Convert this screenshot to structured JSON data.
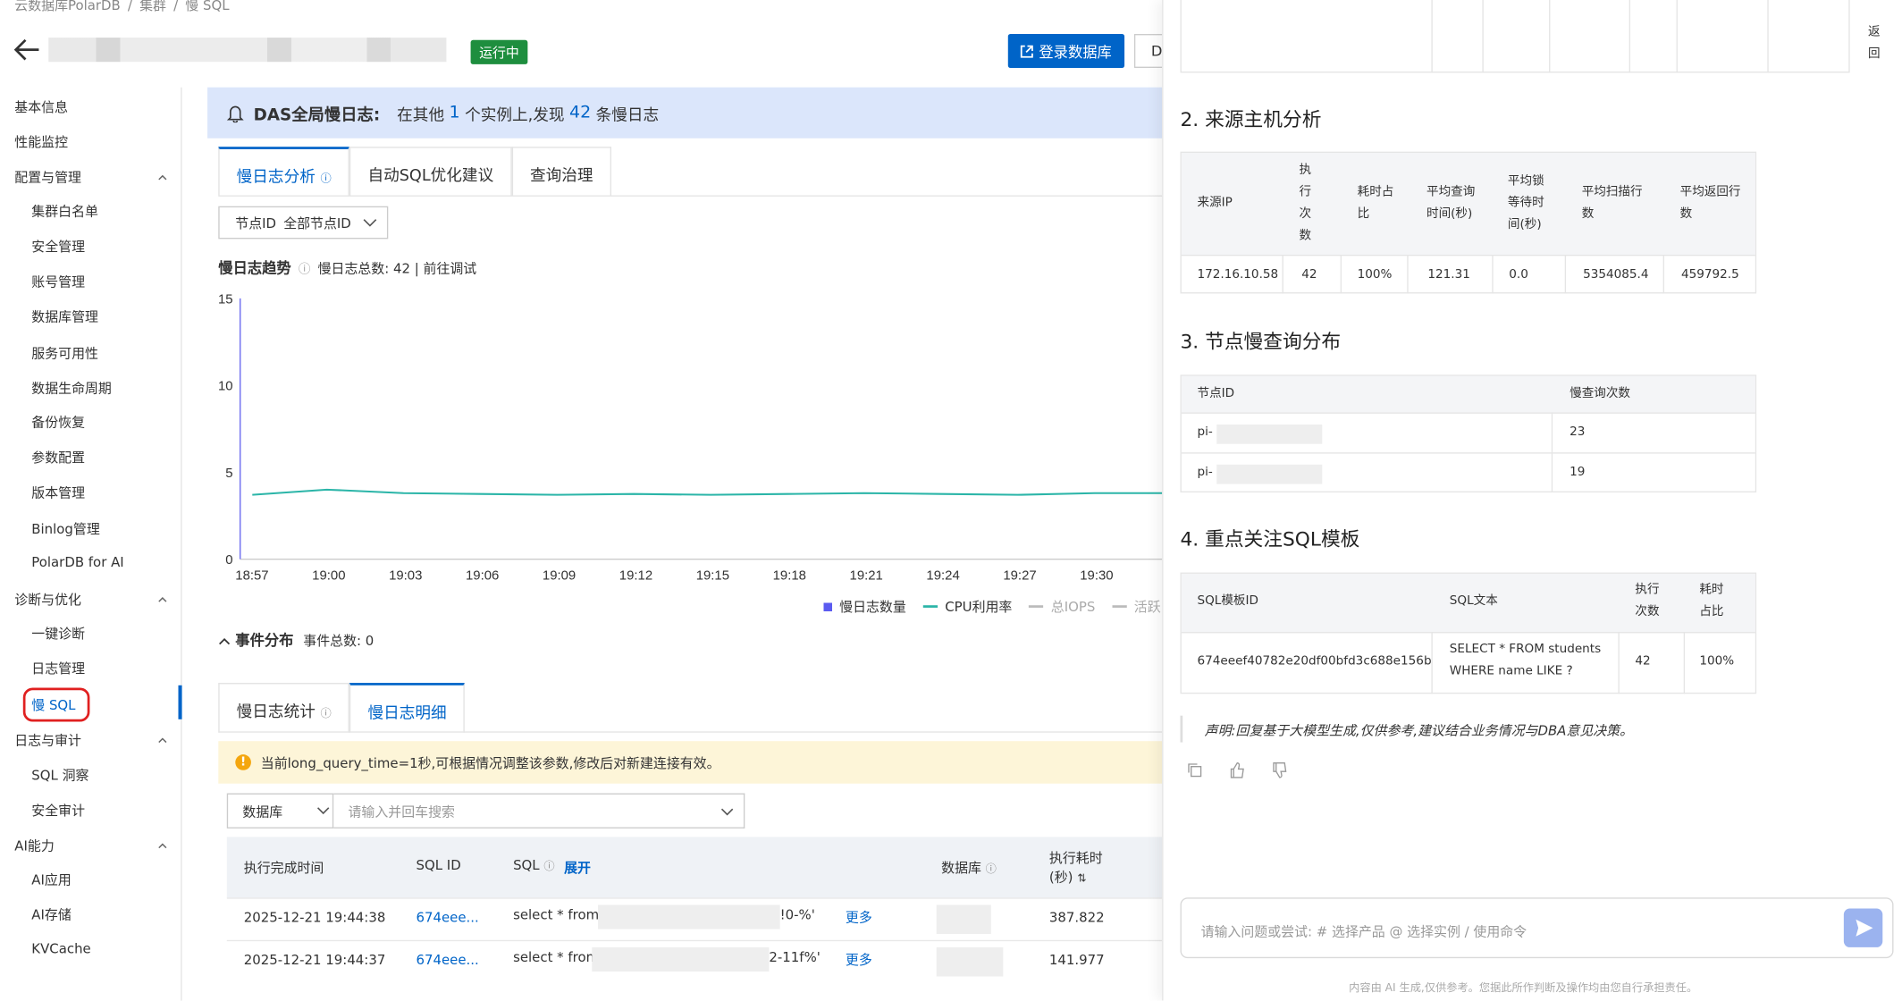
{
  "breadcrumb": [
    "云数据库PolarDB",
    "/",
    "集群",
    "/",
    "慢 SQL"
  ],
  "status_badge": "运行中",
  "header": {
    "login_db": "登录数据库",
    "d_button": "D"
  },
  "sidebar": [
    {
      "label": "基本信息"
    },
    {
      "label": "性能监控"
    },
    {
      "label": "配置与管理",
      "group": true
    },
    {
      "label": "集群白名单"
    },
    {
      "label": "安全管理"
    },
    {
      "label": "账号管理"
    },
    {
      "label": "数据库管理"
    },
    {
      "label": "服务可用性"
    },
    {
      "label": "数据生命周期"
    },
    {
      "label": "备份恢复"
    },
    {
      "label": "参数配置"
    },
    {
      "label": "版本管理"
    },
    {
      "label": "Binlog管理"
    },
    {
      "label": "PolarDB for AI"
    },
    {
      "label": "诊断与优化",
      "group": true
    },
    {
      "label": "一键诊断"
    },
    {
      "label": "日志管理"
    },
    {
      "label": "慢 SQL",
      "active": true
    },
    {
      "label": "日志与审计",
      "group": true
    },
    {
      "label": "SQL 洞察"
    },
    {
      "label": "安全审计"
    },
    {
      "label": "AI能力",
      "group": true
    },
    {
      "label": "AI应用"
    },
    {
      "label": "AI存储"
    },
    {
      "label": "KVCache"
    }
  ],
  "das": {
    "title": "DAS全局慢日志:",
    "pre": "在其他",
    "instances": "1",
    "mid": "个实例上,发现",
    "count": "42",
    "post": "条慢日志"
  },
  "tabs1": [
    "慢日志分析",
    "自动SQL优化建议",
    "查询治理"
  ],
  "node_select": {
    "label": "节点ID",
    "value": "全部节点ID"
  },
  "trend": {
    "title": "慢日志趋势",
    "info": "慢日志总数: 42 | 前往调试"
  },
  "chart_data": {
    "type": "line",
    "x": [
      "18:57",
      "19:00",
      "19:03",
      "19:06",
      "19:09",
      "19:12",
      "19:15",
      "19:18",
      "19:21",
      "19:24",
      "19:27",
      "19:30"
    ],
    "ylim": [
      0,
      15
    ],
    "yticks": [
      "0",
      "5",
      "10",
      "15"
    ],
    "series": [
      {
        "name": "CPU利用率",
        "values": [
          3.7,
          4.0,
          3.8,
          3.75,
          3.7,
          3.75,
          3.7,
          3.75,
          3.8,
          3.75,
          3.7,
          3.8
        ],
        "color": "#2bb5a8"
      }
    ],
    "legend": [
      "慢日志数量",
      "CPU利用率",
      "总IOPS",
      "活跃"
    ],
    "legend_colors": [
      "#5b5bf0",
      "#2bb5a8",
      "#bbbbbb",
      "#bbbbbb"
    ]
  },
  "events": {
    "title": "事件分布",
    "info": "事件总数: 0"
  },
  "tabs2": [
    "慢日志统计",
    "慢日志明细"
  ],
  "warning": "当前long_query_time=1秒,可根据情况调整该参数,修改后对新建连接有效。",
  "filter": {
    "db": "数据库",
    "placeholder": "请输入并回车搜索"
  },
  "table": {
    "headers": [
      "执行完成时间",
      "SQL ID",
      "SQL",
      "展开",
      "数据库",
      "执行耗时",
      "(秒)"
    ],
    "rows": [
      {
        "time": "2025-12-21 19:44:38",
        "sqlid": "674eee...",
        "sql_pre": "select * from s",
        "sql_post": "!0-%'",
        "more": "更多",
        "dur": "387.822"
      },
      {
        "time": "2025-12-21 19:44:37",
        "sqlid": "674eee...",
        "sql_pre": "select * from",
        "sql_post": "2-11f%'",
        "more": "更多",
        "dur": "141.977"
      }
    ]
  },
  "right": {
    "back": "返回",
    "s2": "2. 来源主机分析",
    "t2_headers": [
      "来源IP",
      "执行次数",
      "耗时占比",
      "平均查询时间(秒)",
      "平均锁等待时间(秒)",
      "平均扫描行数",
      "平均返回行数"
    ],
    "t2_row": [
      "172.16.10.58",
      "42",
      "100%",
      "121.31",
      "0.0",
      "5354085.4",
      "459792.5"
    ],
    "s3": "3. 节点慢查询分布",
    "t3_headers": [
      "节点ID",
      "慢查询次数"
    ],
    "t3_rows": [
      [
        "pi-",
        "23"
      ],
      [
        "pi-",
        "19"
      ]
    ],
    "s4": "4. 重点关注SQL模板",
    "t4_headers": [
      "SQL模板ID",
      "SQL文本",
      "执行次数",
      "耗时占比"
    ],
    "t4_row": [
      "674eeef40782e20df00bfd3c688e156b",
      "SELECT * FROM students WHERE name LIKE ?",
      "42",
      "100%"
    ],
    "note": "声明:回复基于大模型生成,仅供参考,建议结合业务情况与DBA意见决策。",
    "chat_placeholder": "请输入问题或尝试: # 选择产品 @ 选择实例 / 使用命令",
    "footer": "内容由 AI 生成,仅供参考。您据此所作判断及操作均由您自行承担责任。"
  }
}
